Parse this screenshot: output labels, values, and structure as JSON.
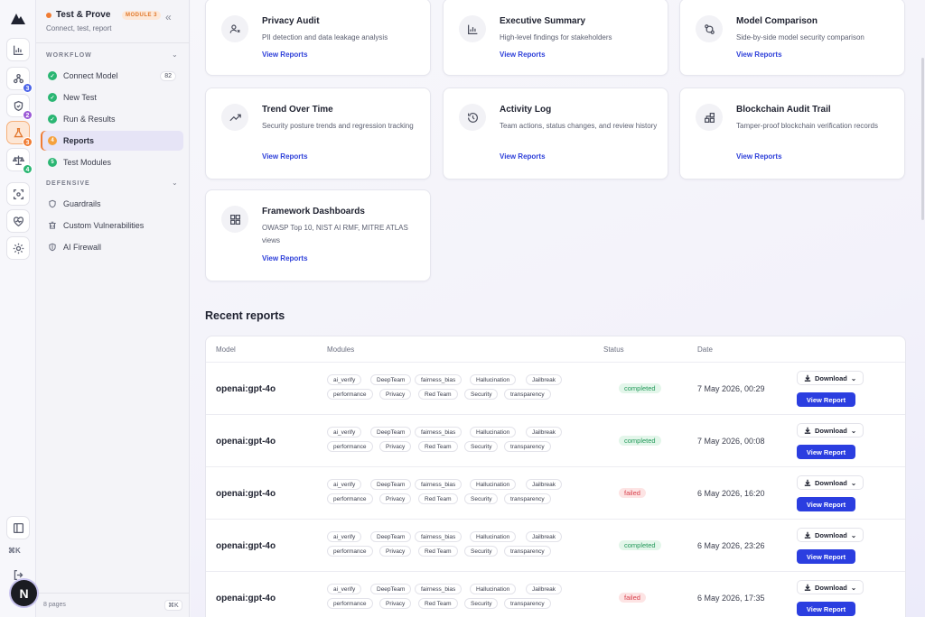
{
  "sidebar": {
    "title": "Test & Prove",
    "module_badge": "MODULE 3",
    "subtitle": "Connect, test, report",
    "collapse_glyph": "«",
    "workflow_label": "WORKFLOW",
    "defensive_label": "DEFENSIVE",
    "workflow_items": [
      {
        "label": "Connect Model",
        "state": "done",
        "count": "82"
      },
      {
        "label": "New Test",
        "state": "done"
      },
      {
        "label": "Run & Results",
        "state": "done"
      },
      {
        "label": "Reports",
        "state": "current",
        "step": "4"
      },
      {
        "label": "Test Modules",
        "state": "todo",
        "step": "5"
      }
    ],
    "defensive_items": [
      {
        "label": "Guardrails",
        "icon": "shield-icon"
      },
      {
        "label": "Custom Vulnerabilities",
        "icon": "bug-icon"
      },
      {
        "label": "AI Firewall",
        "icon": "firewall-icon"
      }
    ],
    "footer_pages": "8 pages",
    "footer_kbd": "⌘K"
  },
  "rail": {
    "badges": [
      "3",
      "2",
      "3",
      "4"
    ],
    "badge_colors": [
      "#4b63e8",
      "#9b59d6",
      "#f07c33",
      "#2bb673"
    ],
    "key_hint": "⌘K",
    "avatar_letter": "N"
  },
  "cards": [
    {
      "title": "Privacy Audit",
      "desc": "PII detection and data leakage analysis",
      "link": "View Reports",
      "icon": "user-x-icon"
    },
    {
      "title": "Executive Summary",
      "desc": "High-level findings for stakeholders",
      "link": "View Reports",
      "icon": "bar-chart-icon"
    },
    {
      "title": "Model Comparison",
      "desc": "Side-by-side model security comparison",
      "link": "View Reports",
      "icon": "git-compare-icon"
    },
    {
      "title": "Trend Over Time",
      "desc": "Security posture trends and regression tracking",
      "link": "View Reports",
      "icon": "trending-up-icon"
    },
    {
      "title": "Activity Log",
      "desc": "Team actions, status changes, and review history",
      "link": "View Reports",
      "icon": "history-icon"
    },
    {
      "title": "Blockchain Audit Trail",
      "desc": "Tamper-proof blockchain verification records",
      "link": "View Reports",
      "icon": "blocks-icon"
    },
    {
      "title": "Framework Dashboards",
      "desc": "OWASP Top 10, NIST AI RMF, MITRE ATLAS views",
      "link": "View Reports",
      "icon": "grid-icon"
    }
  ],
  "recent": {
    "title": "Recent reports",
    "columns": [
      "Model",
      "Modules",
      "Status",
      "Date"
    ],
    "download_label": "Download",
    "view_label": "View Report",
    "modules": [
      "ai_verify",
      "DeepTeam",
      "fairness_bias",
      "Hallucination",
      "Jailbreak",
      "performance",
      "Privacy",
      "Red Team",
      "Security",
      "transparency"
    ],
    "rows": [
      {
        "model": "openai:gpt-4o",
        "status": "completed",
        "date": "7 May 2026, 00:29"
      },
      {
        "model": "openai:gpt-4o",
        "status": "completed",
        "date": "7 May 2026, 00:08"
      },
      {
        "model": "openai:gpt-4o",
        "status": "failed",
        "date": "6 May 2026, 16:20"
      },
      {
        "model": "openai:gpt-4o",
        "status": "completed",
        "date": "6 May 2026, 23:26"
      },
      {
        "model": "openai:gpt-4o",
        "status": "failed",
        "date": "6 May 2026, 17:35"
      }
    ]
  }
}
